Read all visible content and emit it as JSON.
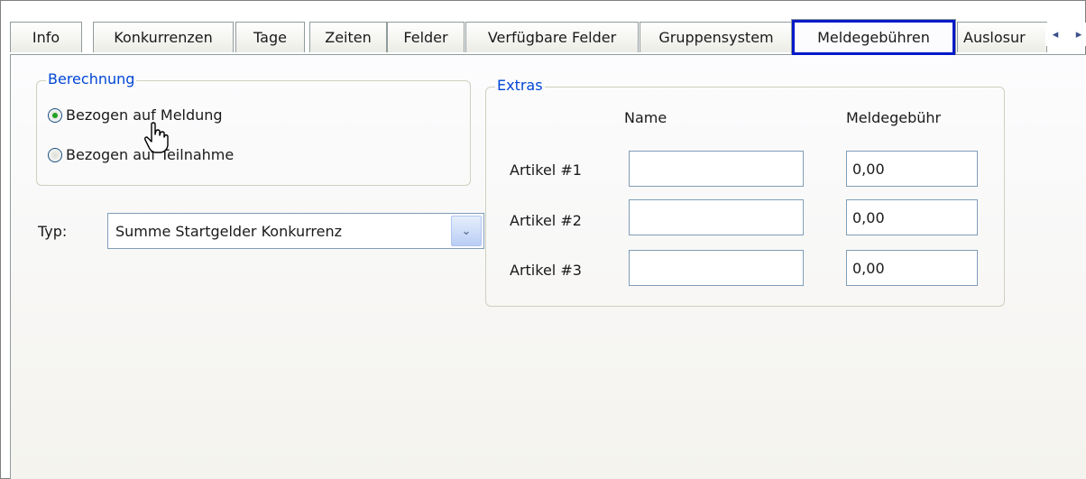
{
  "tabs": [
    {
      "label": "Info",
      "active": false
    },
    {
      "label": "Konkurrenzen",
      "active": false
    },
    {
      "label": "Tage",
      "active": false
    },
    {
      "label": "Zeiten",
      "active": false
    },
    {
      "label": "Felder",
      "active": false
    },
    {
      "label": "Verfügbare Felder",
      "active": false
    },
    {
      "label": "Gruppensystem",
      "active": false
    },
    {
      "label": "Meldegebühren",
      "active": true
    },
    {
      "label": "Auslosur",
      "active": false
    }
  ],
  "tab_scroll": {
    "left_icon": "chevron-left-icon",
    "right_icon": "chevron-right-icon",
    "left_glyph": "◂",
    "right_glyph": "▸"
  },
  "berechnung": {
    "legend": "Berechnung",
    "options": [
      {
        "label": "Bezogen auf Meldung",
        "selected": true
      },
      {
        "label": "Bezogen auf Teilnahme",
        "selected": false
      }
    ]
  },
  "typ": {
    "label": "Typ:",
    "value": "Summe Startgelder Konkurrenz",
    "arrow_glyph": "⌄"
  },
  "extras": {
    "legend": "Extras",
    "col_name": "Name",
    "col_fee": "Meldegebühr",
    "rows": [
      {
        "label": "Artikel #1",
        "name": "",
        "fee": "0,00"
      },
      {
        "label": "Artikel #2",
        "name": "",
        "fee": "0,00"
      },
      {
        "label": "Artikel #3",
        "name": "",
        "fee": "0,00"
      }
    ]
  },
  "colors": {
    "active_tab_highlight": "#0019c9",
    "legend_text": "#0046d5",
    "radio_selected": "#21a121"
  }
}
